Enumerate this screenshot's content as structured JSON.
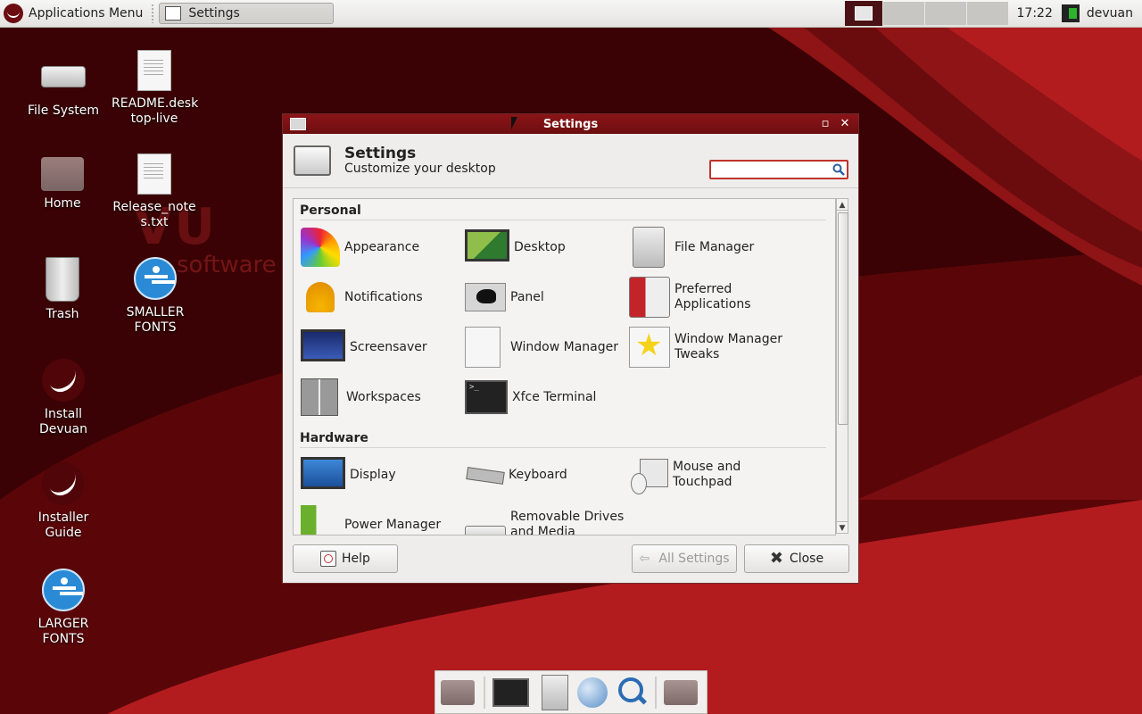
{
  "top_panel": {
    "apps_menu_label": "Applications Menu",
    "task_button_label": "Settings",
    "clock": "17:22",
    "user": "devuan"
  },
  "desktop": {
    "watermark": "VU",
    "watermark_tag": "software",
    "icons": [
      {
        "label": "File System",
        "icon": "drive-icon"
      },
      {
        "label": "README.desk top-live",
        "icon": "document-icon"
      },
      {
        "label": "Home",
        "icon": "home-folder-icon"
      },
      {
        "label": "Release_note s.txt",
        "icon": "document-icon"
      },
      {
        "label": "Trash",
        "icon": "trash-icon"
      },
      {
        "label": "SMALLER FONTS",
        "icon": "accessibility-icon"
      },
      {
        "label": "Install Devuan",
        "icon": "devuan-swirl-icon"
      },
      {
        "label": "Installer Guide",
        "icon": "devuan-swirl-icon"
      },
      {
        "label": "LARGER FONTS",
        "icon": "accessibility-icon"
      }
    ]
  },
  "window": {
    "title": "Settings",
    "header_title": "Settings",
    "header_subtitle": "Customize your desktop",
    "search": {
      "value": "",
      "placeholder": ""
    },
    "sections": [
      {
        "title": "Personal",
        "items": [
          {
            "label": "Appearance",
            "icon": "appearance-icon"
          },
          {
            "label": "Desktop",
            "icon": "desktop-icon"
          },
          {
            "label": "File Manager",
            "icon": "file-manager-icon"
          },
          {
            "label": "Notifications",
            "icon": "notification-bell-icon"
          },
          {
            "label": "Panel",
            "icon": "panel-icon"
          },
          {
            "label": "Preferred Applications",
            "icon": "preferred-applications-icon"
          },
          {
            "label": "Screensaver",
            "icon": "screensaver-icon"
          },
          {
            "label": "Window Manager",
            "icon": "window-manager-icon"
          },
          {
            "label": "Window Manager Tweaks",
            "icon": "window-manager-tweaks-icon"
          },
          {
            "label": "Workspaces",
            "icon": "workspaces-icon"
          },
          {
            "label": "Xfce Terminal",
            "icon": "terminal-icon"
          }
        ]
      },
      {
        "title": "Hardware",
        "items": [
          {
            "label": "Display",
            "icon": "display-icon"
          },
          {
            "label": "Keyboard",
            "icon": "keyboard-icon"
          },
          {
            "label": "Mouse and Touchpad",
            "icon": "mouse-icon"
          },
          {
            "label": "Power Manager",
            "icon": "power-manager-icon"
          },
          {
            "label": "Removable Drives and Media",
            "icon": "removable-drive-icon"
          }
        ]
      }
    ],
    "buttons": {
      "help": "Help",
      "all_settings": "All Settings",
      "close": "Close"
    }
  },
  "dock": {
    "items": [
      "home-folder-icon",
      "terminal-icon",
      "file-manager-icon",
      "web-browser-icon",
      "search-icon",
      "folder-icon"
    ]
  },
  "colors": {
    "accent": "#8b1417",
    "desktop_bg": "#3a0204"
  }
}
